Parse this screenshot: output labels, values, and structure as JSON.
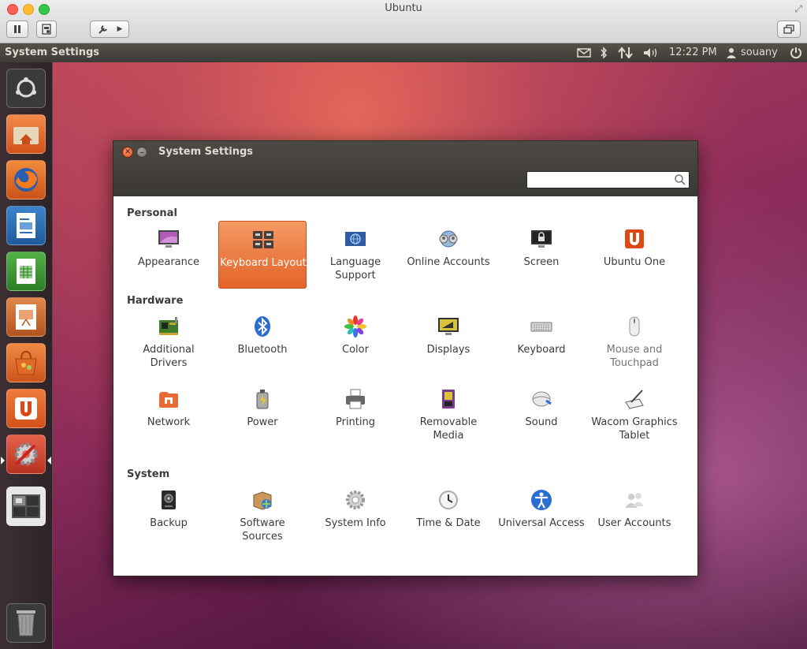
{
  "vm": {
    "title": "Ubuntu"
  },
  "panel": {
    "app_title": "System Settings",
    "time": "12:22 PM",
    "user": "souany"
  },
  "window": {
    "title": "System Settings",
    "search": {
      "value": "",
      "placeholder": ""
    },
    "sections": [
      {
        "label": "Personal",
        "items": [
          {
            "label": "Appearance",
            "icon": "appearance-icon"
          },
          {
            "label": "Keyboard Layout",
            "icon": "keyboard-layout-icon",
            "selected": true
          },
          {
            "label": "Language Support",
            "icon": "language-support-icon"
          },
          {
            "label": "Online Accounts",
            "icon": "online-accounts-icon"
          },
          {
            "label": "Screen",
            "icon": "screen-icon"
          },
          {
            "label": "Ubuntu One",
            "icon": "ubuntu-one-icon"
          }
        ]
      },
      {
        "label": "Hardware",
        "items": [
          {
            "label": "Additional Drivers",
            "icon": "additional-drivers-icon"
          },
          {
            "label": "Bluetooth",
            "icon": "bluetooth-icon"
          },
          {
            "label": "Color",
            "icon": "color-icon"
          },
          {
            "label": "Displays",
            "icon": "displays-icon"
          },
          {
            "label": "Keyboard",
            "icon": "keyboard-icon"
          },
          {
            "label": "Mouse and Touchpad",
            "icon": "mouse-icon"
          },
          {
            "label": "Network",
            "icon": "network-icon"
          },
          {
            "label": "Power",
            "icon": "power-icon"
          },
          {
            "label": "Printing",
            "icon": "printer-icon"
          },
          {
            "label": "Removable Media",
            "icon": "removable-media-icon"
          },
          {
            "label": "Sound",
            "icon": "sound-icon"
          },
          {
            "label": "Wacom Graphics Tablet",
            "icon": "wacom-tablet-icon"
          }
        ]
      },
      {
        "label": "System",
        "items": [
          {
            "label": "Backup",
            "icon": "backup-icon"
          },
          {
            "label": "Software Sources",
            "icon": "software-sources-icon"
          },
          {
            "label": "System Info",
            "icon": "system-info-icon"
          },
          {
            "label": "Time & Date",
            "icon": "clock-icon"
          },
          {
            "label": "Universal Access",
            "icon": "universal-access-icon"
          },
          {
            "label": "User Accounts",
            "icon": "user-accounts-icon"
          }
        ]
      }
    ]
  },
  "launcher": [
    "dash-home-icon",
    "files-folder-icon",
    "firefox-icon",
    "writer-icon",
    "calc-icon",
    "impress-icon",
    "software-center-icon",
    "ubuntu-one-icon",
    "system-settings-icon",
    "workspace-switcher-icon",
    "trash-icon"
  ]
}
